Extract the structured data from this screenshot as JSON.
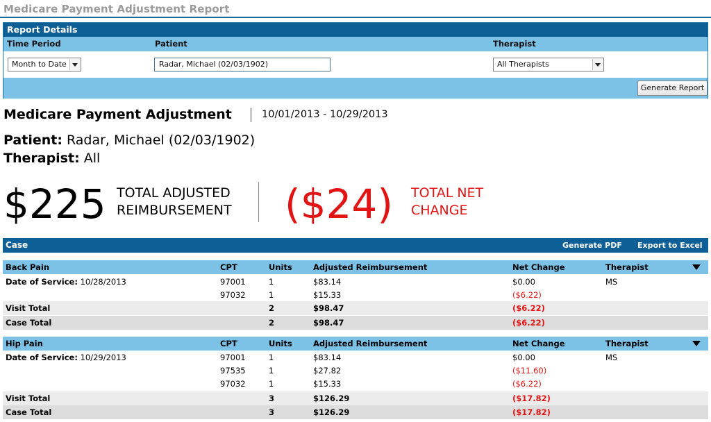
{
  "page_title": "Medicare Payment Adjustment Report",
  "report_details": {
    "header": "Report Details",
    "labels": {
      "time_period": "Time Period",
      "patient": "Patient",
      "therapist": "Therapist"
    },
    "time_period_value": "Month to Date",
    "patient_value": "Radar, Michael (02/03/1902)",
    "therapist_value": "All Therapists",
    "generate_button": "Generate Report"
  },
  "summary": {
    "title": "Medicare Payment Adjustment",
    "date_range": "10/01/2013 - 10/29/2013",
    "patient_label": "Patient:",
    "patient_value": "Radar, Michael (02/03/1902)",
    "therapist_label": "Therapist:",
    "therapist_value": "All",
    "total_adjusted": "$225",
    "total_adjusted_label_1": "TOTAL ADJUSTED",
    "total_adjusted_label_2": "REIMBURSEMENT",
    "total_net": "($24)",
    "total_net_label_1": "TOTAL NET",
    "total_net_label_2": "CHANGE"
  },
  "case_section": {
    "header": "Case",
    "generate_pdf": "Generate PDF",
    "export_excel": "Export to Excel",
    "columns": {
      "cpt": "CPT",
      "units": "Units",
      "adjusted": "Adjusted Reimbursement",
      "net": "Net Change",
      "therapist": "Therapist"
    },
    "cases": [
      {
        "name": "Back Pain",
        "dos_label": "Date of Service:",
        "dos_value": "10/28/2013",
        "therapist": "MS",
        "lines": [
          {
            "cpt": "97001",
            "units": "1",
            "adjusted": "$83.14",
            "net": "$0.00"
          },
          {
            "cpt": "97032",
            "units": "1",
            "adjusted": "$15.33",
            "net": "($6.22)"
          }
        ],
        "visit_total": {
          "label": "Visit Total",
          "units": "2",
          "adjusted": "$98.47",
          "net": "($6.22)"
        },
        "case_total": {
          "label": "Case Total",
          "units": "2",
          "adjusted": "$98.47",
          "net": "($6.22)"
        }
      },
      {
        "name": "Hip Pain",
        "dos_label": "Date of Service:",
        "dos_value": "10/29/2013",
        "therapist": "MS",
        "lines": [
          {
            "cpt": "97001",
            "units": "1",
            "adjusted": "$83.14",
            "net": "$0.00"
          },
          {
            "cpt": "97535",
            "units": "1",
            "adjusted": "$27.82",
            "net": "($11.60)"
          },
          {
            "cpt": "97032",
            "units": "1",
            "adjusted": "$15.33",
            "net": "($6.22)"
          }
        ],
        "visit_total": {
          "label": "Visit Total",
          "units": "3",
          "adjusted": "$126.29",
          "net": "($17.82)"
        },
        "case_total": {
          "label": "Case Total",
          "units": "3",
          "adjusted": "$126.29",
          "net": "($17.82)"
        }
      }
    ]
  },
  "colors": {
    "header_blue": "#0e5f96",
    "light_blue": "#7cc1e6",
    "negative_red": "#e21313"
  }
}
